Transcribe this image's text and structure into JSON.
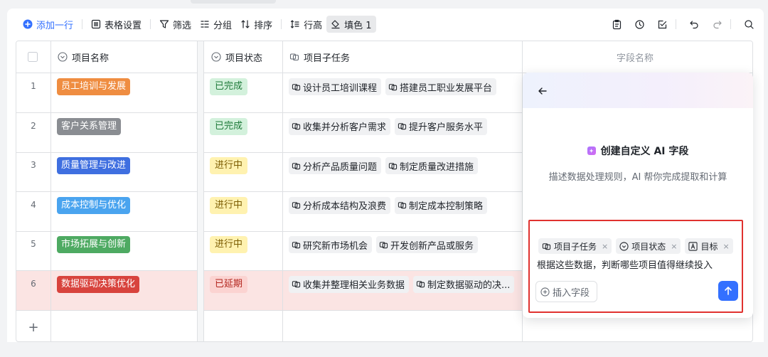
{
  "toolbar": {
    "add_row": "添加一行",
    "table_settings": "表格设置",
    "filter": "筛选",
    "group": "分组",
    "sort": "排序",
    "row_height": "行高",
    "fill_color": "填色 1"
  },
  "columns": {
    "name": "项目名称",
    "status": "项目状态",
    "subtasks": "项目子任务",
    "field_name": "字段名称"
  },
  "rows": [
    {
      "num": "1",
      "name": "员工培训与发展",
      "name_color": "#ef8d41",
      "status": "已完成",
      "status_type": "done",
      "subtasks": [
        "设计员工培训课程",
        "搭建员工职业发展平台"
      ]
    },
    {
      "num": "2",
      "name": "客户关系管理",
      "name_color": "#8a8d92",
      "status": "已完成",
      "status_type": "done",
      "subtasks": [
        "收集并分析客户需求",
        "提升客户服务水平"
      ]
    },
    {
      "num": "3",
      "name": "质量管理与改进",
      "name_color": "#3f6fe0",
      "status": "进行中",
      "status_type": "progress",
      "subtasks": [
        "分析产品质量问题",
        "制定质量改进措施"
      ]
    },
    {
      "num": "4",
      "name": "成本控制与优化",
      "name_color": "#4aa4ef",
      "status": "进行中",
      "status_type": "progress",
      "subtasks": [
        "分析成本结构及浪费",
        "制定成本控制策略"
      ]
    },
    {
      "num": "5",
      "name": "市场拓展与创新",
      "name_color": "#4eaa62",
      "status": "进行中",
      "status_type": "progress",
      "subtasks": [
        "研究新市场机会",
        "开发创新产品或服务"
      ]
    },
    {
      "num": "6",
      "name": "数据驱动决策优化",
      "name_color": "#d8433d",
      "status": "已延期",
      "status_type": "delayed",
      "subtasks": [
        "收集并整理相关业务数据",
        "制定数据驱动的决..."
      ]
    }
  ],
  "add_row_symbol": "+",
  "panel": {
    "title": "创建自定义 AI 字段",
    "description": "描述数据处理规则，AI 帮你完成提取和计算",
    "field_tags": [
      "项目子任务",
      "项目状态",
      "目标"
    ],
    "tag_close": "×",
    "prompt_text": "根据这些数据，判断哪些项目值得继续投入",
    "insert_field": "插入字段"
  },
  "colors": {
    "accent": "#3370ff",
    "done_bg": "#d3f1dc",
    "done_fg": "#1f7a3a",
    "progress_bg": "#fff2b0",
    "progress_fg": "#7a5b00",
    "delayed_bg": "#fbd3d1",
    "delayed_fg": "#b3261e",
    "highlight_outline": "#e0322f"
  }
}
